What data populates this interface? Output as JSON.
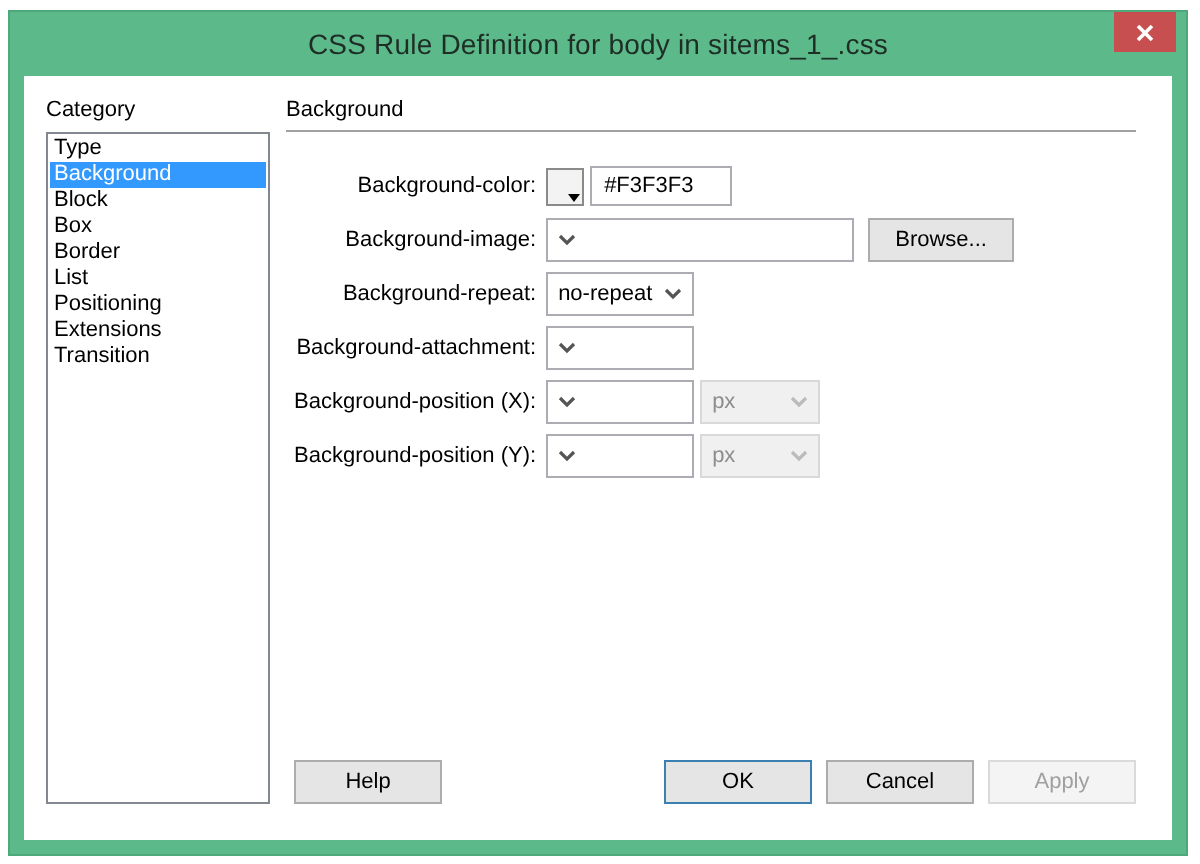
{
  "window": {
    "title": "CSS Rule Definition for body in sitems_1_.css"
  },
  "category": {
    "label": "Category",
    "items": [
      {
        "label": "Type",
        "selected": false
      },
      {
        "label": "Background",
        "selected": true
      },
      {
        "label": "Block",
        "selected": false
      },
      {
        "label": "Box",
        "selected": false
      },
      {
        "label": "Border",
        "selected": false
      },
      {
        "label": "List",
        "selected": false
      },
      {
        "label": "Positioning",
        "selected": false
      },
      {
        "label": "Extensions",
        "selected": false
      },
      {
        "label": "Transition",
        "selected": false
      }
    ]
  },
  "panel": {
    "title": "Background",
    "fields": [
      {
        "kind": "color",
        "label": "Background-color:",
        "value": "#F3F3F3"
      },
      {
        "kind": "browse",
        "label": "Background-image:",
        "button": "Browse..."
      },
      {
        "kind": "select",
        "label": "Background-repeat:",
        "value": "no-repeat"
      },
      {
        "kind": "select",
        "label": "Background-attachment:"
      },
      {
        "kind": "unit",
        "label": "Background-position (X):",
        "unit": "px",
        "unit_disabled": true
      },
      {
        "kind": "unit",
        "label": "Background-position (Y):",
        "unit": "px",
        "unit_disabled": true
      }
    ]
  },
  "buttons": [
    {
      "label": "Help",
      "default": false,
      "disabled": false
    },
    {
      "label": "OK",
      "default": true,
      "disabled": false
    },
    {
      "label": "Cancel",
      "default": false,
      "disabled": false
    },
    {
      "label": "Apply",
      "default": false,
      "disabled": true
    }
  ]
}
